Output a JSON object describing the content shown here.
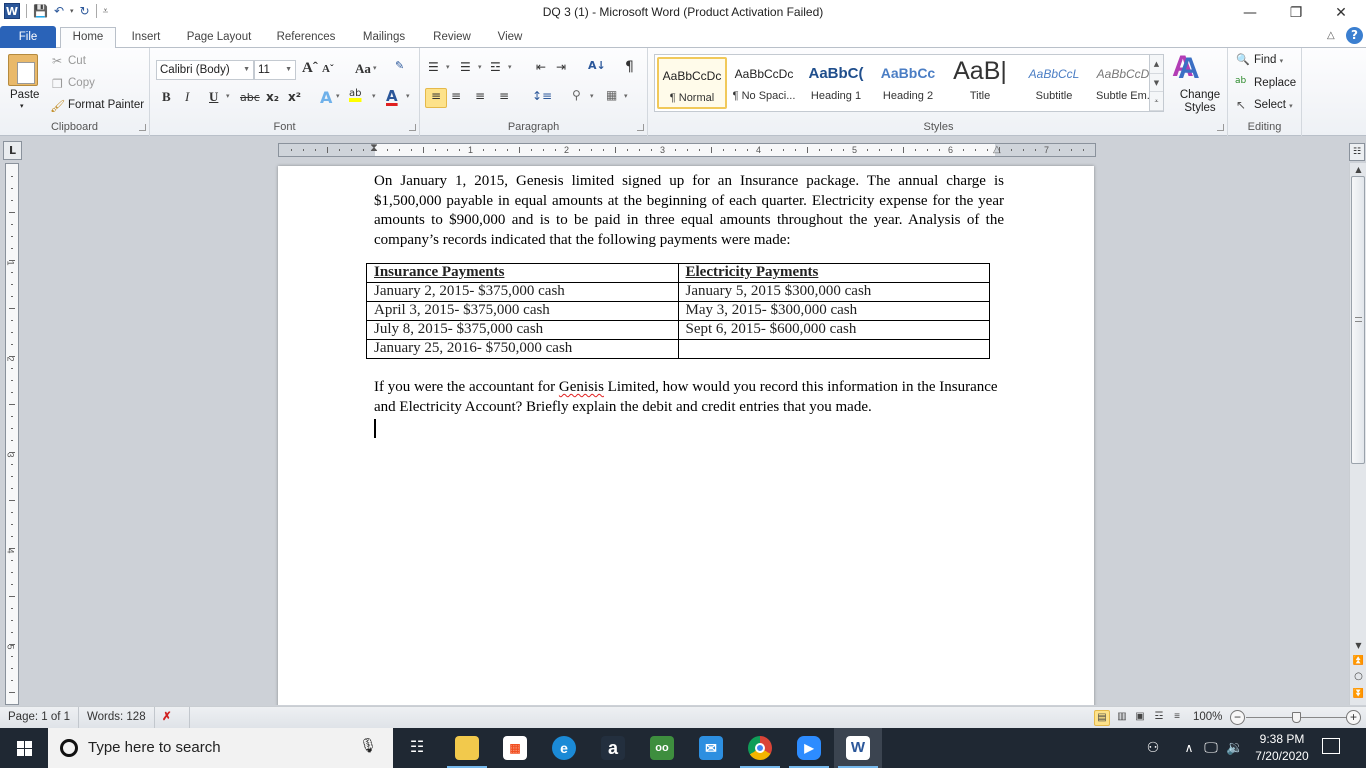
{
  "window": {
    "title": "DQ 3 (1)  -  Microsoft Word (Product Activation Failed)",
    "app_icon": "W",
    "qat": {
      "save": "save-icon",
      "undo": "undo-icon",
      "redo": "redo-icon",
      "customize": "customize-qat-icon"
    },
    "controls": {
      "minimize": "—",
      "restore": "❐",
      "close": "✕"
    }
  },
  "tabs": [
    {
      "label": "File"
    },
    {
      "label": "Home",
      "active": true
    },
    {
      "label": "Insert"
    },
    {
      "label": "Page Layout"
    },
    {
      "label": "References"
    },
    {
      "label": "Mailings"
    },
    {
      "label": "Review"
    },
    {
      "label": "View"
    }
  ],
  "ribbon": {
    "clipboard": {
      "label": "Clipboard",
      "paste": "Paste",
      "cut": "Cut",
      "copy": "Copy",
      "format_painter": "Format Painter"
    },
    "font": {
      "label": "Font",
      "font_name": "Calibri (Body)",
      "font_size": "11",
      "grow": "Aˆ",
      "shrink": "Aˇ",
      "change_case": "Aa",
      "bold": "B",
      "italic": "I",
      "underline": "U",
      "strikethrough": "abc",
      "subscript": "x₂",
      "superscript": "x²",
      "highlight_color": "#ffff00",
      "font_color": "#e02020"
    },
    "paragraph": {
      "label": "Paragraph",
      "show_marks": "¶"
    },
    "styles": {
      "label": "Styles",
      "items": [
        {
          "preview": "AaBbCcDc",
          "name": "¶ Normal",
          "active": true
        },
        {
          "preview": "AaBbCcDc",
          "name": "¶ No Spaci..."
        },
        {
          "preview": "AaBbC(",
          "name": "Heading 1"
        },
        {
          "preview": "AaBbCc",
          "name": "Heading 2"
        },
        {
          "preview": "AaB|",
          "name": "Title"
        },
        {
          "preview": "AaBbCcL",
          "name": "Subtitle"
        },
        {
          "preview": "AaBbCcDc",
          "name": "Subtle Em..."
        }
      ],
      "change_styles": "Change Styles"
    },
    "editing": {
      "label": "Editing",
      "find": "Find",
      "replace": "Replace",
      "select": "Select"
    }
  },
  "ruler": {
    "numbers": [
      "1",
      "2",
      "3",
      "4",
      "5",
      "6",
      "7"
    ],
    "vertical_numbers": [
      "1",
      "2",
      "3",
      "4",
      "5"
    ]
  },
  "document": {
    "paragraph1": "On January 1, 2015, Genesis limited signed up for an Insurance package. The annual charge is $1,500,000 payable in equal amounts at the beginning of each quarter. Electricity expense for the year amounts to $900,000 and is to be paid in three equal amounts throughout the year. Analysis of the company’s records indicated that the following payments were made:",
    "table": {
      "headers": [
        "Insurance Payments",
        "Electricity Payments"
      ],
      "rows": [
        [
          "January 2, 2015- $375,000 cash",
          "January 5, 2015 $300,000 cash"
        ],
        [
          "April 3, 2015- $375,000 cash",
          "May 3, 2015- $300,000 cash"
        ],
        [
          "July 8, 2015- $375,000 cash",
          "Sept 6, 2015- $600,000 cash"
        ],
        [
          "January 25, 2016- $750,000 cash",
          ""
        ]
      ]
    },
    "paragraph2_before": "If you were the accountant for ",
    "paragraph2_misspelled": "Genisis",
    "paragraph2_after": " Limited, how would you record this information in the Insurance and Electricity Account? Briefly explain the debit and credit entries that you made."
  },
  "statusbar": {
    "page": "Page: 1 of 1",
    "words": "Words: 128",
    "proofing": "proofing-error-icon",
    "zoom": "100%",
    "zoom_percent": 100
  },
  "taskbar": {
    "search_placeholder": "Type here to search",
    "apps": [
      "task-view",
      "file-explorer",
      "microsoft-store",
      "edge",
      "amazon",
      "tripadvisor",
      "mail",
      "chrome",
      "zoom",
      "word"
    ],
    "time": "9:38 PM",
    "date": "7/20/2020"
  }
}
